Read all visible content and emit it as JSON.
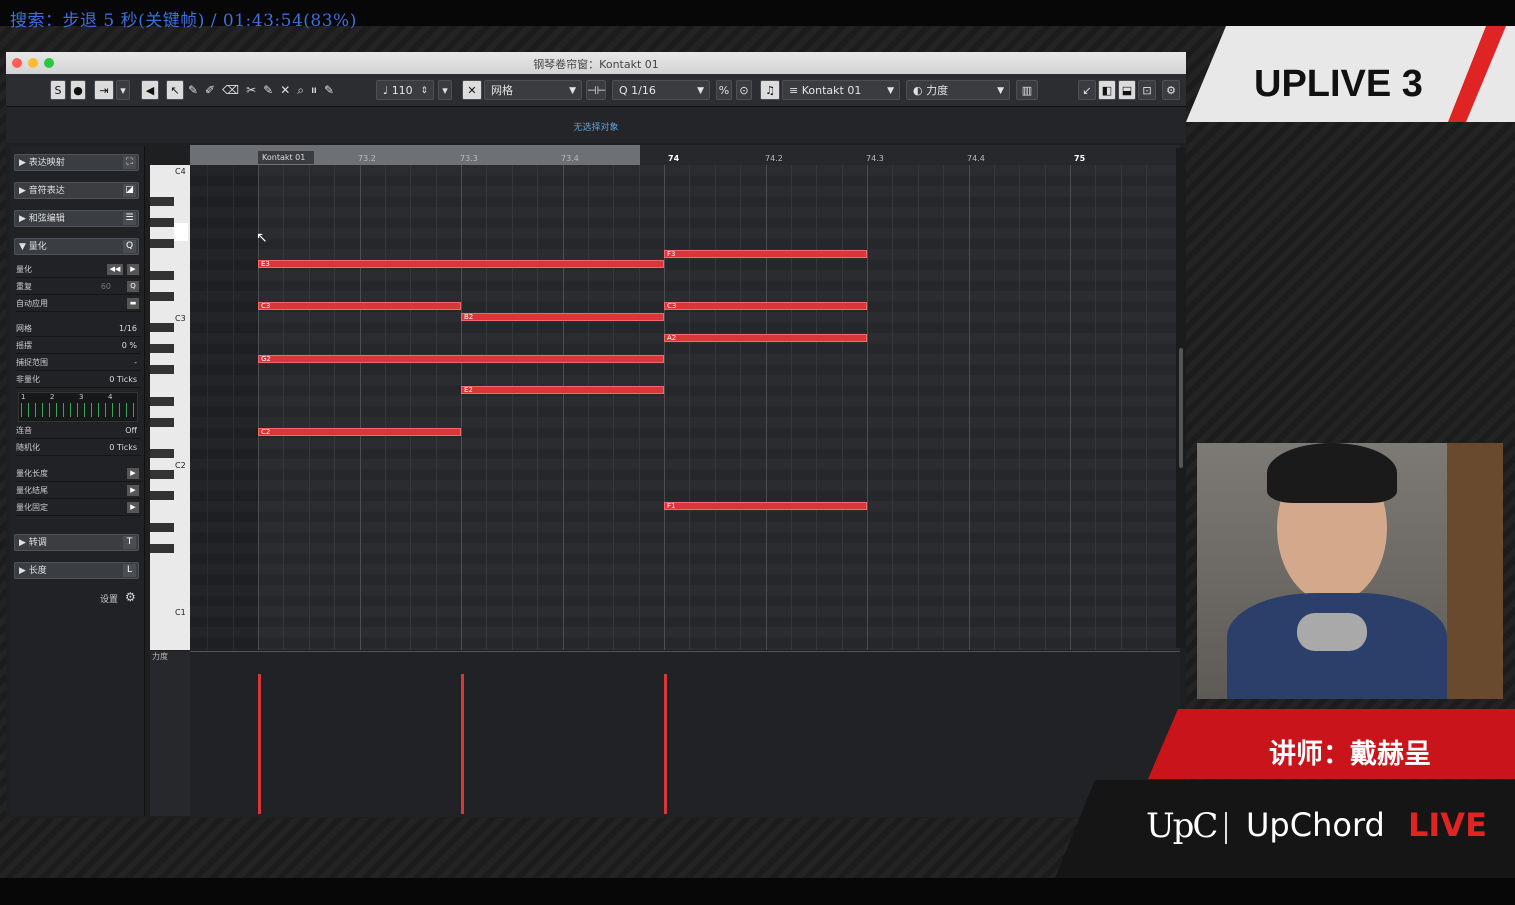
{
  "overlay": {
    "search_status": "搜索：步退 5 秒(关键帧) / 01:43:54(83%)"
  },
  "window": {
    "title": "钢琴卷帘窗：Kontakt 01"
  },
  "toolbar": {
    "tempo": "110",
    "snap_mode": "网格",
    "quantize": "1/16",
    "instrument": "Kontakt 01",
    "lane_param": "力度"
  },
  "info_line": {
    "text": "无选择对象"
  },
  "inspector": {
    "sections": [
      "表达映射",
      "音符表达",
      "和弦编辑",
      "量化"
    ],
    "quantize_rows": [
      {
        "label": "量化",
        "value": ""
      },
      {
        "label": "重复",
        "value": "60"
      },
      {
        "label": "自动应用",
        "value": ""
      }
    ],
    "params": [
      {
        "label": "网格",
        "value": "1/16"
      },
      {
        "label": "摇摆",
        "value": "0 %"
      },
      {
        "label": "捕捉范围",
        "value": "-"
      },
      {
        "label": "非量化",
        "value": "0 Ticks"
      }
    ],
    "beat_numbers": [
      "1",
      "2",
      "3",
      "4"
    ],
    "params2": [
      {
        "label": "连音",
        "value": "Off"
      },
      {
        "label": "随机化",
        "value": "0 Ticks"
      }
    ],
    "apply_rows": [
      "量化长度",
      "量化结尾",
      "量化固定"
    ],
    "bottom_sections": [
      "转调",
      "长度"
    ],
    "settings": "设置"
  },
  "ruler": {
    "part_name": "Kontakt 01",
    "ticks": [
      "73.2",
      "73.3",
      "73.4",
      "74",
      "74.2",
      "74.3",
      "74.4",
      "75"
    ]
  },
  "keyboard": {
    "octave_labels": [
      "C4",
      "C3",
      "C2",
      "C1"
    ],
    "velocity_label": "力度"
  },
  "notes": [
    {
      "pitch": "E3",
      "start": 73.1,
      "end": 74
    },
    {
      "pitch": "C3",
      "start": 73.1,
      "end": 73.3
    },
    {
      "pitch": "G2",
      "start": 73.1,
      "end": 74
    },
    {
      "pitch": "C2",
      "start": 73.1,
      "end": 73.3
    },
    {
      "pitch": "B2",
      "start": 73.3,
      "end": 74
    },
    {
      "pitch": "E2",
      "start": 73.3,
      "end": 74
    },
    {
      "pitch": "F3",
      "start": 74,
      "end": 74.3
    },
    {
      "pitch": "C3",
      "start": 74,
      "end": 74.3
    },
    {
      "pitch": "A2",
      "start": 74,
      "end": 74.3
    },
    {
      "pitch": "F1",
      "start": 74,
      "end": 74.3
    }
  ],
  "stream": {
    "show_logo": "UPLIVE 3",
    "lecturer": "讲师：戴赫呈",
    "brand_mark": "UpC",
    "brand_name": "UpChord",
    "brand_live": "LIVE"
  },
  "colors": {
    "note": "#d9363a",
    "accent": "#e02424",
    "search_text": "#3d6fe0"
  }
}
